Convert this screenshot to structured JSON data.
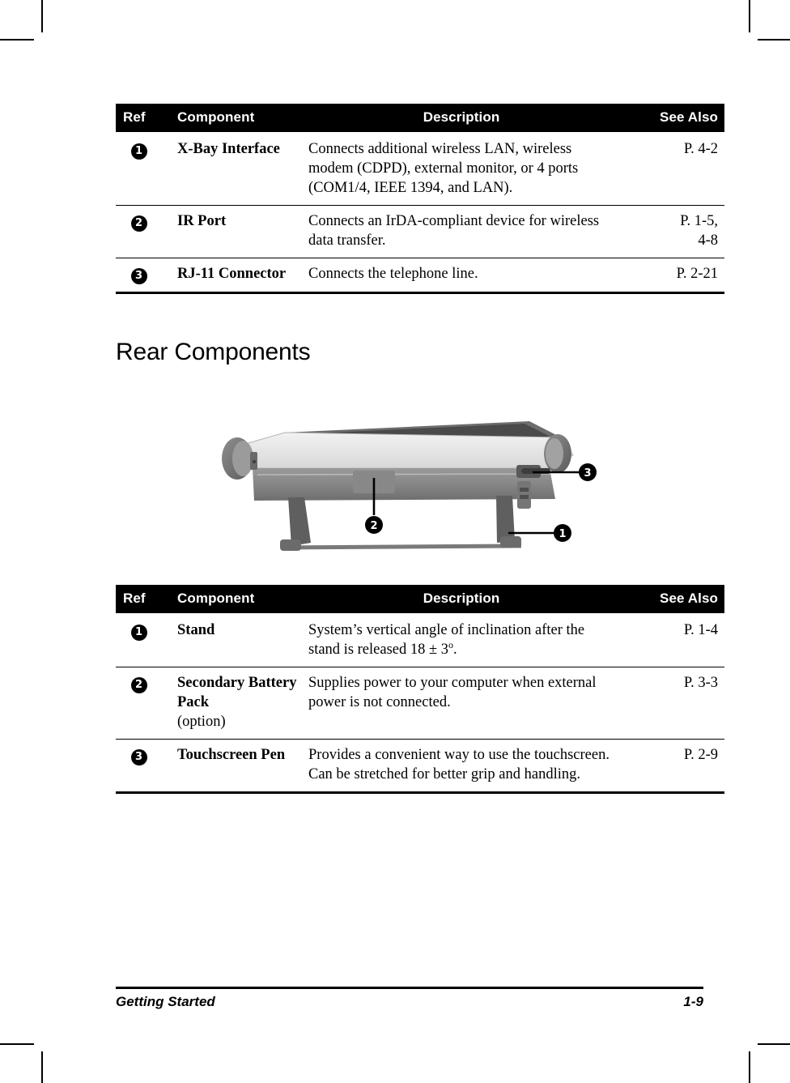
{
  "page": {
    "section_heading": "Rear Components",
    "footer_left": "Getting Started",
    "footer_page": "1-9"
  },
  "table_headers": {
    "ref": "Ref",
    "component": "Component",
    "description": "Description",
    "see_also": "See Also"
  },
  "table_top": {
    "rows": [
      {
        "ref": "1",
        "component": "X-Bay Interface",
        "description": "Connects additional wireless LAN, wireless modem (CDPD), external monitor, or 4 ports (COM1/4, IEEE 1394, and LAN).",
        "see_also": "P. 4-2"
      },
      {
        "ref": "2",
        "component": "IR Port",
        "description": "Connects an IrDA-compliant device for wireless data transfer.",
        "see_also": "P. 1-5,\n4-8"
      },
      {
        "ref": "3",
        "component": "RJ-11 Connector",
        "description": "Connects the telephone line.",
        "see_also": "P. 2-21"
      }
    ]
  },
  "table_rear": {
    "rows": [
      {
        "ref": "1",
        "component": "Stand",
        "component_note": "",
        "description_pre": "System’s vertical angle of inclination after the stand is released 18 ± 3",
        "description_sup": "o",
        "description_post": ".",
        "see_also": "P. 1-4"
      },
      {
        "ref": "2",
        "component": "Secondary Battery Pack",
        "component_note": "(option)",
        "description_pre": "Supplies power to your computer when external power is not connected.",
        "description_sup": "",
        "description_post": "",
        "see_also": "P. 3-3"
      },
      {
        "ref": "3",
        "component": "Touchscreen Pen",
        "component_note": "",
        "description_pre": "Provides a convenient way to use the touchscreen. Can be stretched for better grip and handling.",
        "description_sup": "",
        "description_post": "",
        "see_also": "P. 2-9"
      }
    ]
  },
  "figure": {
    "alt": "rear view of rugged tablet computer with deployed stand",
    "callouts": [
      {
        "number": "1",
        "target": "stand leg"
      },
      {
        "number": "2",
        "target": "secondary battery pack"
      },
      {
        "number": "3",
        "target": "touchscreen pen"
      }
    ]
  },
  "colors": {
    "header_bar": "#000000",
    "header_text": "#ffffff",
    "body_text": "#000000",
    "page_bg": "#ffffff"
  }
}
